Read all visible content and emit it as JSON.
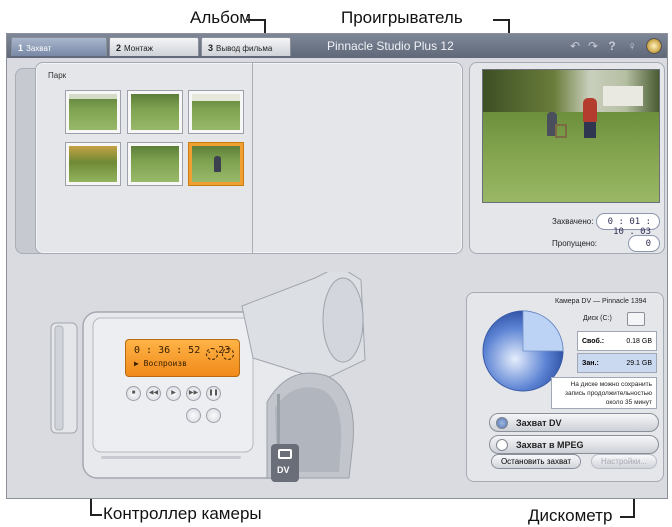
{
  "callouts": {
    "album": "Альбом",
    "player": "Проигрыватель",
    "camera": "Контроллер камеры",
    "disk": "Дискометр"
  },
  "app": {
    "title": "Pinnacle Studio Plus 12",
    "tabs": [
      {
        "num": "1",
        "label": "Захват"
      },
      {
        "num": "2",
        "label": "Монтаж"
      },
      {
        "num": "3",
        "label": "Вывод фильма"
      }
    ],
    "toolbar_icons": [
      "undo-icon",
      "redo-icon",
      "help-icon",
      "tip-icon",
      "settings-icon"
    ]
  },
  "album": {
    "section_label": "Парк",
    "selected_index": 5
  },
  "player": {
    "captured_label": "Захвачено:",
    "captured_value": "0 : 01 : 10 . 03",
    "dropped_label": "Пропущено:",
    "dropped_value": "0"
  },
  "camera": {
    "timecode": "0 : 36 : 52 . 23",
    "status": "▶ Воспроизв",
    "side_label": "DV"
  },
  "disk": {
    "title": "Камера DV — Pinnacle 1394",
    "drive_label": "Диск (C:)",
    "free_label": "Своб.:",
    "free_value": "0.18 GB",
    "used_label": "Зан.:",
    "used_value": "29.1 GB",
    "note": "На диске можно сохранить запись продолжительностью около 35 минут",
    "options": [
      "Захват DV",
      "Захват в MPEG"
    ],
    "selected_option": 0,
    "stop_button": "Остановить захват",
    "settings_button": "Настройки..."
  },
  "colors": {
    "accent_orange": "#f08a1a",
    "title_bar": "#6b7486",
    "pie_blue": "#2f58b8"
  }
}
